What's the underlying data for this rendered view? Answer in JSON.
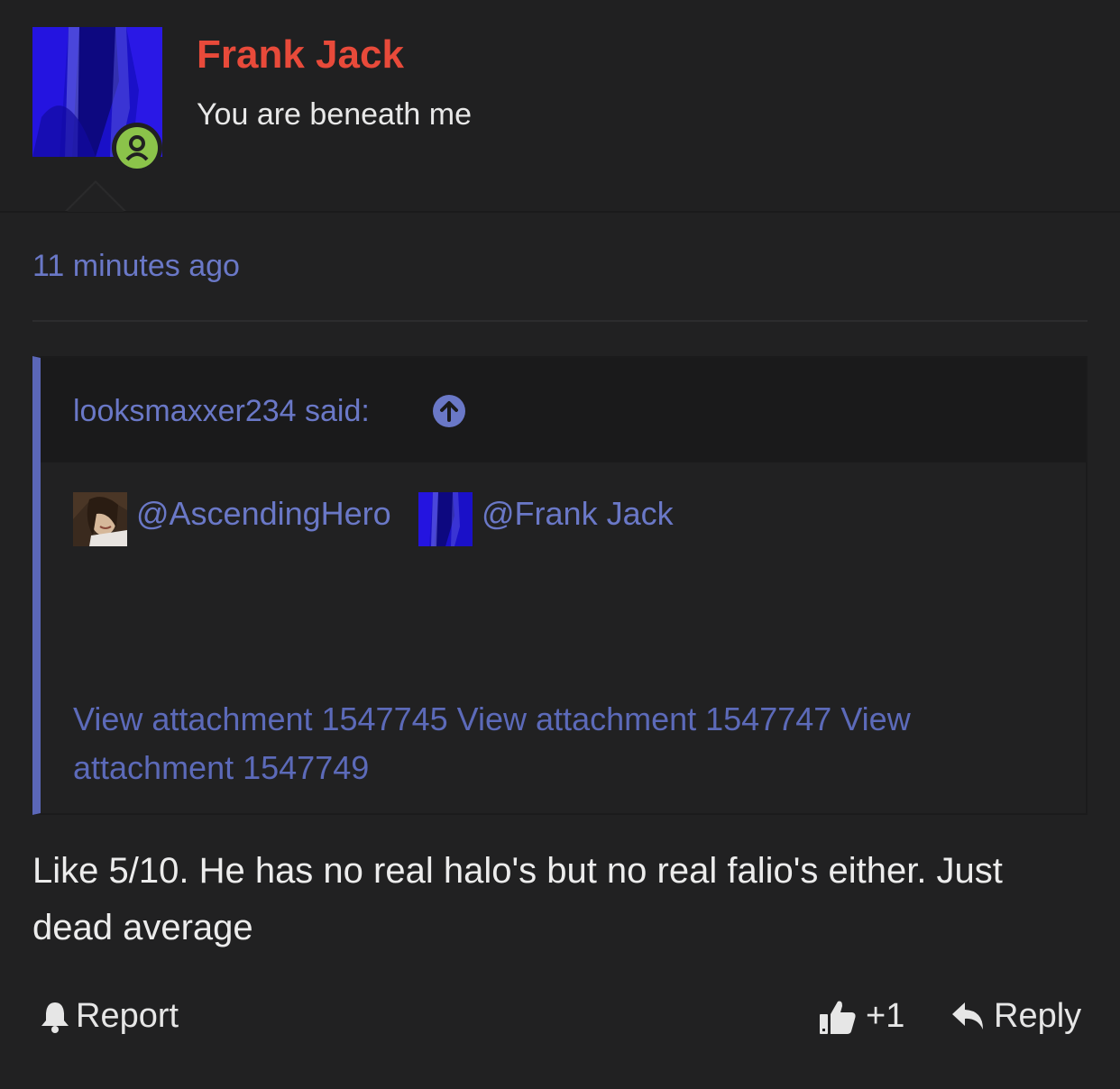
{
  "header": {
    "username": "Frank Jack",
    "user_title": "You are beneath me",
    "avatar_icon": "user-avatar",
    "online_icon": "user-circle-icon",
    "name_color": "#e84a3a",
    "online_color": "#8bc34a"
  },
  "post": {
    "timestamp": "11 minutes ago",
    "body": "Like 5/10. He has no real halo's but no real falio's either. Just dead average"
  },
  "quote": {
    "author": "looksmaxxer234 said:",
    "jump_icon": "arrow-up-circle-icon",
    "mentions": [
      "@AscendingHero",
      "@Frank Jack"
    ],
    "text": "",
    "attachments": [
      "View attachment 1547745",
      "View attachment 1547747",
      "View attachment 1547749"
    ]
  },
  "actions": {
    "report_label": "Report",
    "report_icon": "bell-icon",
    "like_label": "+1",
    "like_icon": "thumbs-up-icon",
    "reply_label": "Reply",
    "reply_icon": "reply-icon"
  },
  "colors": {
    "background": "#212122",
    "link": "#6a78c7",
    "quote_bar": "#5b67b8"
  }
}
